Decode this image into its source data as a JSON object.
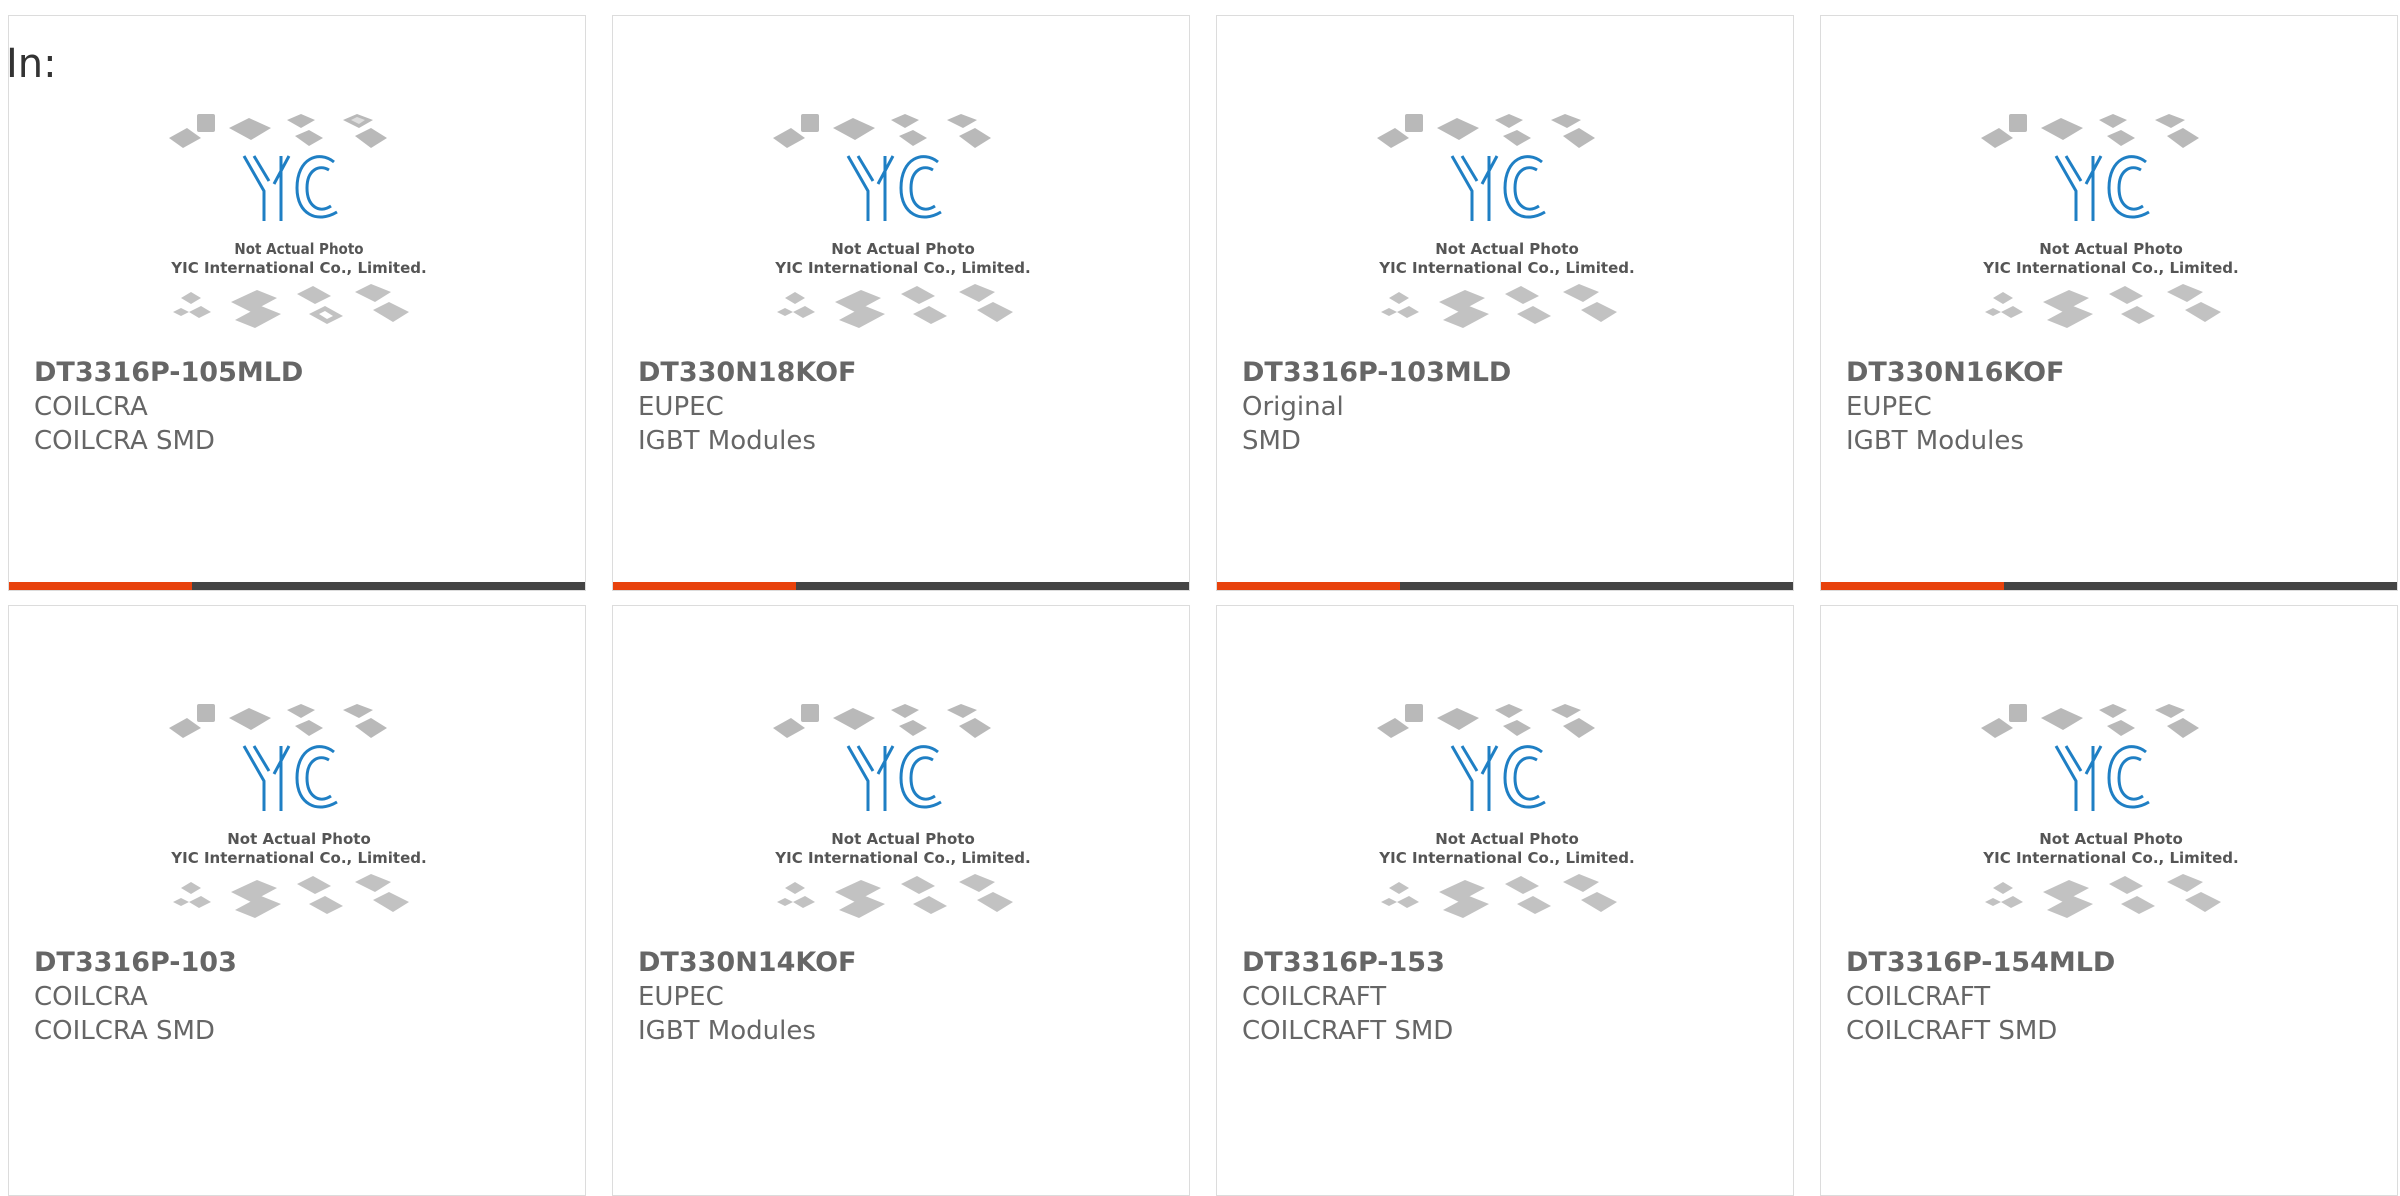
{
  "header": {
    "label": "In:"
  },
  "placeholder": {
    "caption_line1": "Not Actual Photo",
    "caption_line2": "YIC International Co., Limited."
  },
  "colors": {
    "accent": "#e8420c",
    "bar": "#444444",
    "logo": "#1f7fc4"
  },
  "products": [
    {
      "part": "DT3316P-105MLD",
      "manufacturer": "COILCRA",
      "category": "COILCRA SMD"
    },
    {
      "part": "DT330N18KOF",
      "manufacturer": "EUPEC",
      "category": "IGBT Modules"
    },
    {
      "part": "DT3316P-103MLD",
      "manufacturer": "Original",
      "category": "SMD"
    },
    {
      "part": "DT330N16KOF",
      "manufacturer": "EUPEC",
      "category": "IGBT Modules"
    },
    {
      "part": "DT3316P-103",
      "manufacturer": "COILCRA",
      "category": "COILCRA SMD"
    },
    {
      "part": "DT330N14KOF",
      "manufacturer": "EUPEC",
      "category": "IGBT Modules"
    },
    {
      "part": "DT3316P-153",
      "manufacturer": "COILCRAFT",
      "category": "COILCRAFT SMD"
    },
    {
      "part": "DT3316P-154MLD",
      "manufacturer": "COILCRAFT",
      "category": "COILCRAFT SMD"
    }
  ]
}
